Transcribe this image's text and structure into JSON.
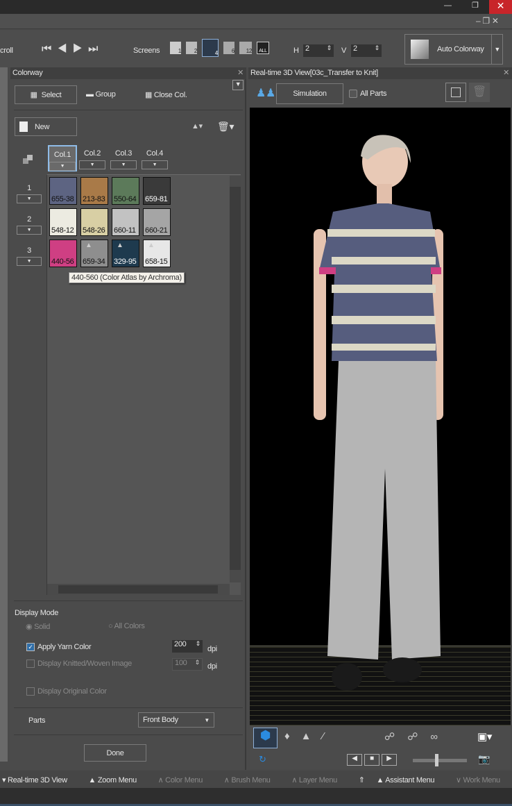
{
  "toolbar": {
    "scroll_label": "croll",
    "screens_label": "Screens",
    "screen_options": [
      "1",
      "2",
      "4",
      "6",
      "12",
      "ALL"
    ],
    "selected_screen": "4",
    "h_label": "H",
    "h_value": "2",
    "v_label": "V",
    "v_value": "2",
    "auto_colorway": "Auto Colorway"
  },
  "colorway": {
    "title": "Colorway",
    "select": "Select",
    "group": "Group",
    "close_col": "Close Col.",
    "new": "New",
    "columns": [
      "Col.1",
      "Col.2",
      "Col.3",
      "Col.4"
    ],
    "rows": [
      "1",
      "2",
      "3"
    ],
    "swatches": [
      [
        {
          "code": "655-38",
          "color": "#5d6482",
          "text": "#111"
        },
        {
          "code": "213-83",
          "color": "#a97a48",
          "text": "#111"
        },
        {
          "code": "550-64",
          "color": "#5c7a5a",
          "text": "#111"
        },
        {
          "code": "659-81",
          "color": "#3a3a3a",
          "text": "#fff"
        }
      ],
      [
        {
          "code": "548-12",
          "color": "#ecebe1",
          "text": "#111"
        },
        {
          "code": "548-26",
          "color": "#d8cfa4",
          "text": "#111"
        },
        {
          "code": "660-11",
          "color": "#c2c2c2",
          "text": "#111"
        },
        {
          "code": "660-21",
          "color": "#a5a5a5",
          "text": "#111"
        }
      ],
      [
        {
          "code": "440-56",
          "color": "#cf3f83",
          "text": "#111"
        },
        {
          "code": "659-34",
          "color": "#8e8e8e",
          "text": "#111"
        },
        {
          "code": "329-95",
          "color": "#1e3a4e",
          "text": "#fff"
        },
        {
          "code": "658-15",
          "color": "#e7e7e7",
          "text": "#111"
        }
      ]
    ],
    "tooltip": "440-560 (Color Atlas by Archroma)",
    "display_mode": "Display Mode",
    "solid": "Solid",
    "all_colors": "All Colors",
    "apply_yarn": "Apply Yarn Color",
    "apply_yarn_checked": true,
    "apply_dpi": "200",
    "dpi": "dpi",
    "knitted": "Display Knitted/Woven Image",
    "knitted_dpi": "100",
    "original": "Display Original Color",
    "parts_label": "Parts",
    "parts_value": "Front Body",
    "done": "Done"
  },
  "view": {
    "title": "Real-time 3D View[03c_Transfer to Knit]",
    "simulation": "Simulation",
    "all_parts": "All Parts"
  },
  "menu": {
    "items": [
      "Real-time 3D View",
      "Zoom Menu",
      "Color Menu",
      "Brush Menu",
      "Layer Menu",
      "Assistant Menu",
      "Work Menu"
    ]
  }
}
